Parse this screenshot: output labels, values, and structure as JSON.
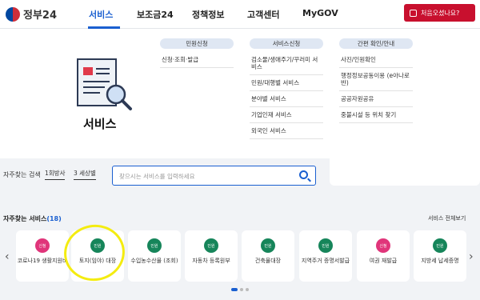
{
  "header": {
    "logo_text": "정부24",
    "nav": [
      {
        "label": "서비스",
        "active": true
      },
      {
        "label": "보조금24",
        "active": false
      },
      {
        "label": "정책정보",
        "active": false
      },
      {
        "label": "고객센터",
        "active": false
      },
      {
        "label": "MyGOV",
        "active": false
      }
    ],
    "cta_label": "처음오셨나요?"
  },
  "mega_menu": {
    "title": "서비스",
    "columns": [
      {
        "heading": "민원신청",
        "items": [
          "신청·조회·발급"
        ]
      },
      {
        "heading": "서비스신청",
        "items": [
          "검소물/생애주기/꾸러미 서비스",
          "민원/대행별 서비스",
          "분야별 서비스",
          "기업인재 서비스",
          "외국인 서비스"
        ]
      },
      {
        "heading": "간편 확인/안내",
        "items": [
          "사진/인원확인",
          "행정정보공동이용 (e아나로반)",
          "공공자원공유",
          "중불시설 등 위치 찾기"
        ]
      }
    ]
  },
  "search": {
    "freq_label": "자주찾는 검색",
    "select1": "1회방사",
    "select2": "3 세상별",
    "placeholder": "찾으시는 서비스를 입력하세요"
  },
  "services": {
    "title": "자주찾는 서비스",
    "count": "(18)",
    "view_all": "서비스 전체보기",
    "cards": [
      {
        "badge": "신청",
        "badge_color": "#e0357a",
        "label": "코로나19 생활지원비"
      },
      {
        "badge": "민원",
        "badge_color": "#16855a",
        "label": "토지(임야) 대장"
      },
      {
        "badge": "민원",
        "badge_color": "#16855a",
        "label": "수입농수산물 (조회)"
      },
      {
        "badge": "민원",
        "badge_color": "#16855a",
        "label": "자동차 등록원부"
      },
      {
        "badge": "민원",
        "badge_color": "#16855a",
        "label": "건축물대장"
      },
      {
        "badge": "민원",
        "badge_color": "#16855a",
        "label": "지역주거 증명서발급"
      },
      {
        "badge": "신청",
        "badge_color": "#e0357a",
        "label": "여권 재발급"
      },
      {
        "badge": "민원",
        "badge_color": "#16855a",
        "label": "지방세 납세증명"
      }
    ],
    "prev_arrow": "‹",
    "next_arrow": "›"
  },
  "colors": {
    "accent": "#1a5fd0",
    "cta": "#c8102e",
    "highlight": "#f4ec10"
  }
}
